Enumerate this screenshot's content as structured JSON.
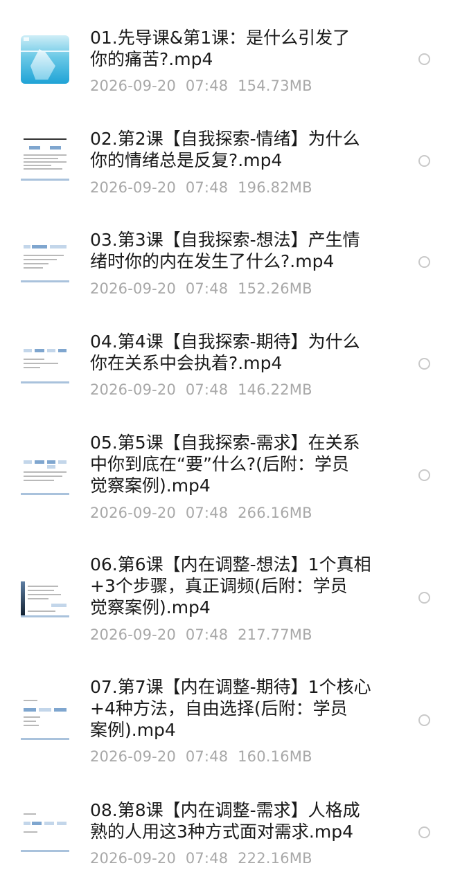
{
  "files": [
    {
      "name_lines": [
        "01.先导课&第1课：是什么引发了",
        "你的痛苦?.mp4"
      ],
      "date": "2026-09-20",
      "time": "07:48",
      "size": "154.73MB",
      "thumbnail": "iceberg-thumbnail",
      "selected": false
    },
    {
      "name_lines": [
        "02.第2课【自我探索-情绪】为什么",
        "你的情绪总是反复?.mp4"
      ],
      "date": "2026-09-20",
      "time": "07:48",
      "size": "196.82MB",
      "thumbnail": "slide-thumbnail",
      "selected": false
    },
    {
      "name_lines": [
        "03.第3课【自我探索-想法】产生情",
        "绪时你的内在发生了什么?.mp4"
      ],
      "date": "2026-09-20",
      "time": "07:48",
      "size": "152.26MB",
      "thumbnail": "slide-thumbnail",
      "selected": false
    },
    {
      "name_lines": [
        "04.第4课【自我探索-期待】为什么",
        "你在关系中会执着?.mp4"
      ],
      "date": "2026-09-20",
      "time": "07:48",
      "size": "146.22MB",
      "thumbnail": "slide-thumbnail",
      "selected": false
    },
    {
      "name_lines": [
        "05.第5课【自我探索-需求】在关系",
        "中你到底在“要”什么?(后附：学员",
        "觉察案例).mp4"
      ],
      "date": "2026-09-20",
      "time": "07:48",
      "size": "266.16MB",
      "thumbnail": "slide-thumbnail",
      "selected": false
    },
    {
      "name_lines": [
        "06.第6课【内在调整-想法】1个真相",
        "+3个步骤，真正调频(后附：学员",
        "觉察案例).mp4"
      ],
      "date": "2026-09-20",
      "time": "07:48",
      "size": "217.77MB",
      "thumbnail": "slide-thumbnail",
      "selected": false
    },
    {
      "name_lines": [
        "07.第7课【内在调整-期待】1个核心",
        "+4种方法，自由选择(后附：学员",
        "案例).mp4"
      ],
      "date": "2026-09-20",
      "time": "07:48",
      "size": "160.16MB",
      "thumbnail": "slide-thumbnail",
      "selected": false
    },
    {
      "name_lines": [
        "08.第8课【内在调整-需求】人格成",
        "熟的人用这3种方式面对需求.mp4"
      ],
      "date": "2026-09-20",
      "time": "07:48",
      "size": "222.16MB",
      "thumbnail": "slide-thumbnail",
      "selected": false
    }
  ]
}
